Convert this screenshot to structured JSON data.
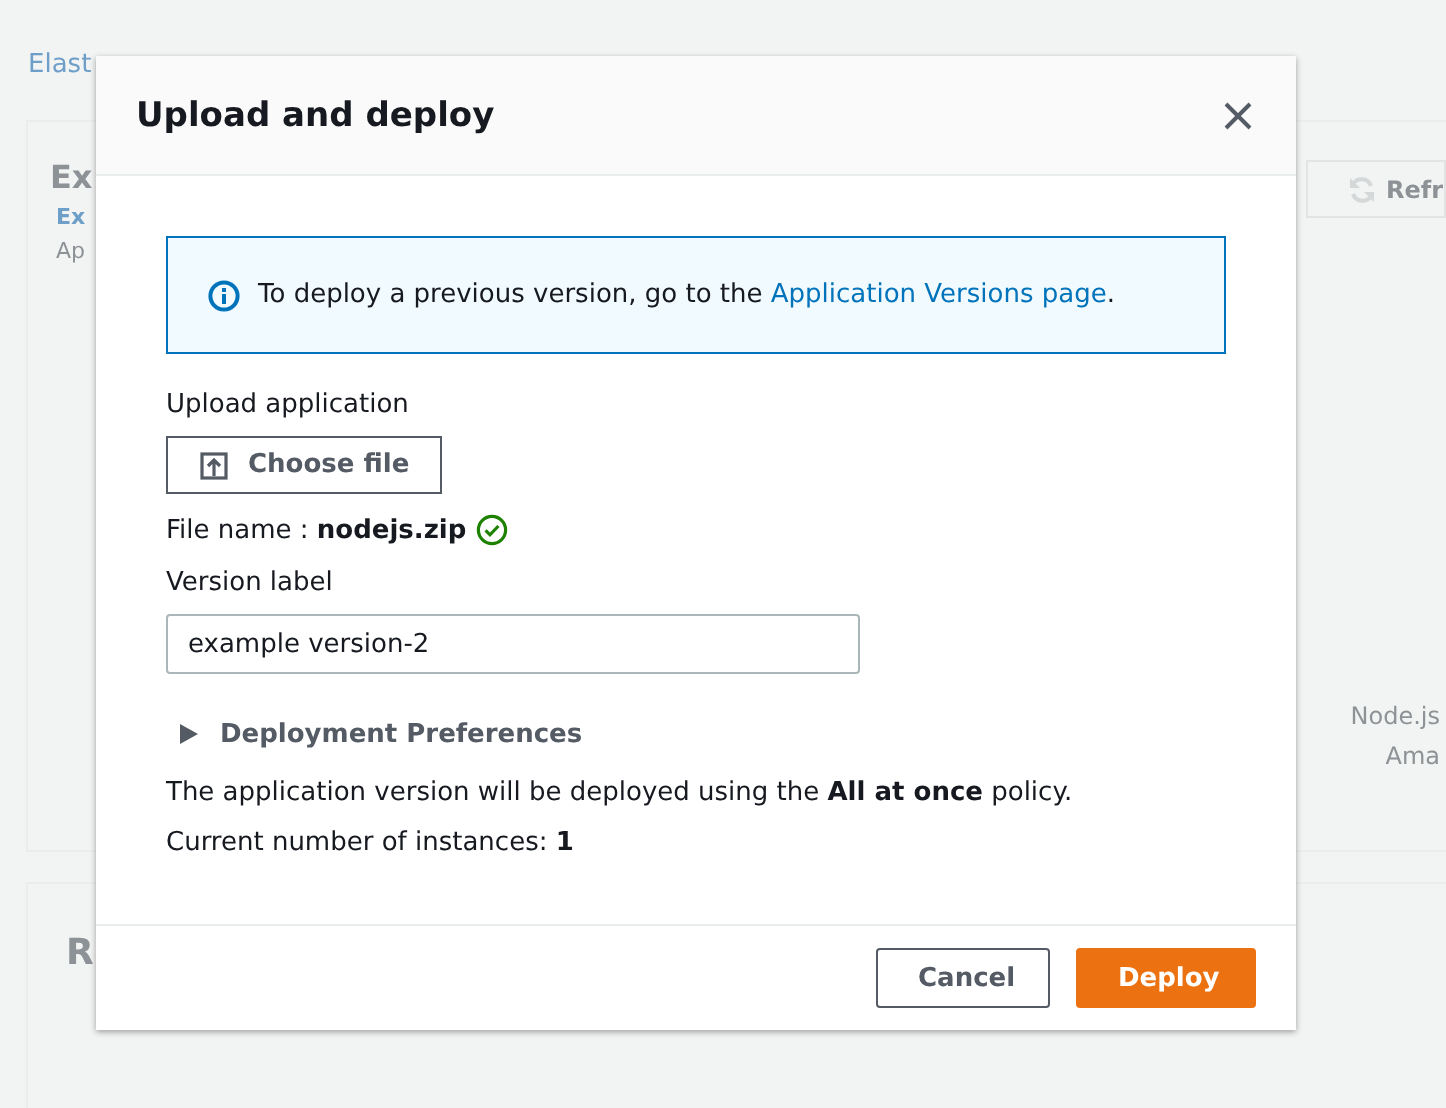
{
  "background": {
    "breadcrumb": "Elast",
    "heading": "Ex",
    "link": "Ex",
    "subtext": "Ap",
    "refresh_button": "Refr",
    "platform_lines": [
      "Node.js",
      "Ama"
    ],
    "section_heading": "R"
  },
  "modal": {
    "title": "Upload and deploy",
    "info": {
      "text": "To deploy a previous version, go to the ",
      "link": "Application Versions page",
      "after": "."
    },
    "upload_label": "Upload application",
    "choose_button": "Choose file",
    "file_name_label": "File name : ",
    "file_name": "nodejs.zip",
    "file_valid": true,
    "version_label": "Version label",
    "version_value": "example version-2",
    "preferences": {
      "label": "Deployment Preferences",
      "expanded": false
    },
    "policy_text": "The application version will be deployed using the **All at once** policy.",
    "instances_text": "Current number of instances: **1**",
    "buttons": [
      {
        "label": "Cancel",
        "kind": "secondary"
      },
      {
        "label": "Deploy",
        "kind": "primary"
      }
    ]
  }
}
